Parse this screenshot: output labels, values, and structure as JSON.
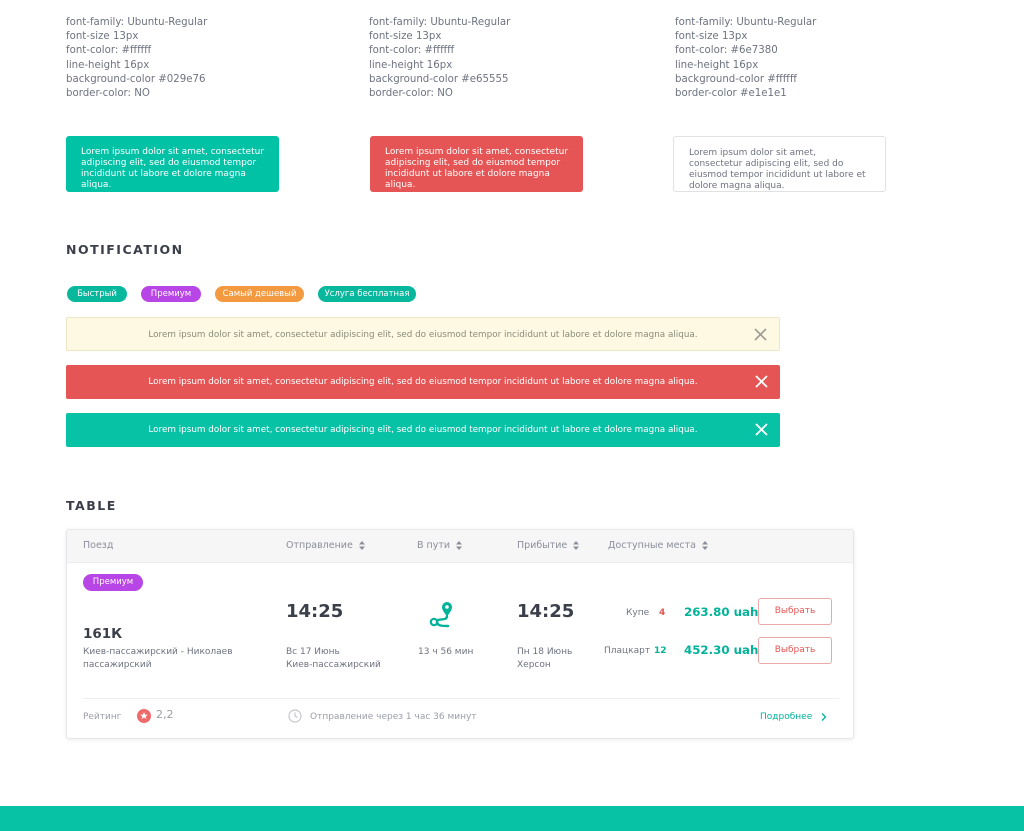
{
  "specs": [
    {
      "lines": [
        "font-family: Ubuntu-Regular",
        "font-size 13px",
        "font-color: #ffffff",
        "line-height 16px",
        "background-color #029e76",
        "border-color: NO"
      ]
    },
    {
      "lines": [
        "font-family: Ubuntu-Regular",
        "font-size 13px",
        "font-color: #ffffff",
        "line-height 16px",
        "background-color #e65555",
        "border-color: NO"
      ]
    },
    {
      "lines": [
        "font-family: Ubuntu-Regular",
        "font-size 13px",
        "font-color: #6e7380",
        "line-height 16px",
        "background-color #ffffff",
        "border-color #e1e1e1"
      ]
    }
  ],
  "samples": [
    {
      "text": "Lorem ipsum dolor sit amet, consectetur adipiscing elit, sed do eiusmod tempor incididunt ut labore et dolore magna aliqua.",
      "bg": "#02c2a6"
    },
    {
      "text": "Lorem ipsum dolor sit amet, consectetur adipiscing elit, sed do eiusmod tempor incididunt ut labore et dolore magna aliqua.",
      "bg": "#e65555"
    },
    {
      "text": "Lorem ipsum dolor sit amet, consectetur adipiscing elit, sed do eiusmod tempor incididunt ut labore et dolore magna aliqua.",
      "bg": "#ffffff"
    }
  ],
  "notification": {
    "title": "NOTIFICATION",
    "tags": [
      {
        "label": "Быстрый",
        "color": "#08b89c"
      },
      {
        "label": "Премиум",
        "color": "#b845e6"
      },
      {
        "label": "Самый дешевый",
        "color": "#f39a40"
      },
      {
        "label": "Услуга бесплатная",
        "color": "#08b89c"
      }
    ],
    "bars": [
      {
        "text": "Lorem ipsum dolor sit amet, consectetur adipiscing elit, sed do eiusmod tempor incididunt ut labore et dolore magna aliqua.",
        "bg": "#fdf9e3",
        "fg": "#8a8c7a"
      },
      {
        "text": "Lorem ipsum dolor sit amet, consectetur adipiscing elit, sed do eiusmod tempor incididunt ut labore et dolore magna aliqua.",
        "bg": "#e65555",
        "fg": "#ffffff"
      },
      {
        "text": "Lorem ipsum dolor sit amet, consectetur adipiscing elit, sed do eiusmod tempor incididunt ut labore et dolore magna aliqua.",
        "bg": "#08c2a6",
        "fg": "#ffffff"
      }
    ]
  },
  "table": {
    "title": "TABLE",
    "headers": {
      "train": "Поезд",
      "departure": "Отправление",
      "in_transit": "В пути",
      "arrival": "Прибытие",
      "seats": "Доступные места"
    },
    "row": {
      "badge": "Премиум",
      "train_number": "161К",
      "route_line1": "Киев-пассажирский - Николаев",
      "route_line2": "пассажирский",
      "dep_time": "14:25",
      "dep_date": "Вс 17 Июнь",
      "dep_station": "Киев-пассажирский",
      "duration": "13 ч 56 мин",
      "arr_time": "14:25",
      "arr_date": "Пн 18 Июнь",
      "arr_station": "Херсон",
      "classes": [
        {
          "name": "Купе",
          "count": "4",
          "count_color": "#e65555",
          "price": "263.80 uah",
          "button": "Выбрать"
        },
        {
          "name": "Плацкарт",
          "count": "12",
          "count_color": "#02b39a",
          "price": "452.30 uah",
          "button": "Выбрать"
        }
      ]
    },
    "footer": {
      "rating_label": "Рейтинг",
      "rating_value": "2,2",
      "departure_in": "Отправление через 1 час 36 минут",
      "more": "Подробнее"
    }
  }
}
